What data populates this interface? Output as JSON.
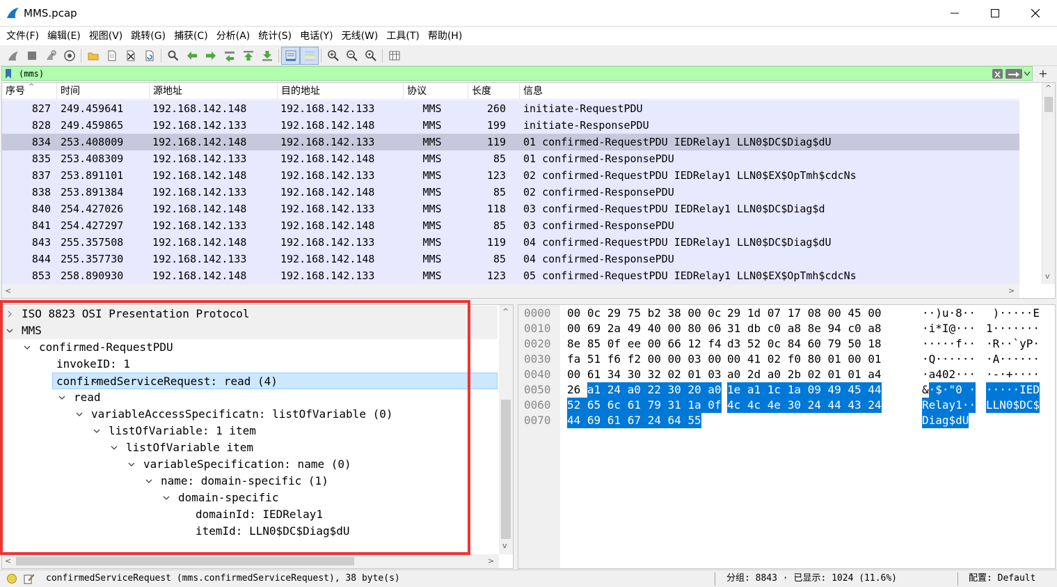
{
  "window": {
    "title": "MMS.pcap"
  },
  "menu": [
    {
      "label": "文件(F)"
    },
    {
      "label": "编辑(E)"
    },
    {
      "label": "视图(V)"
    },
    {
      "label": "跳转(G)"
    },
    {
      "label": "捕获(C)"
    },
    {
      "label": "分析(A)"
    },
    {
      "label": "统计(S)"
    },
    {
      "label": "电话(Y)"
    },
    {
      "label": "无线(W)"
    },
    {
      "label": "工具(T)"
    },
    {
      "label": "帮助(H)"
    }
  ],
  "toolbar": {
    "icons": [
      "shark-fin-start-icon",
      "stop-icon",
      "restart-icon",
      "capture-options-icon",
      "open-file-icon",
      "file-icon",
      "close-file-icon",
      "reload-icon",
      "find-icon",
      "back-arrow-icon",
      "forward-arrow-icon",
      "go-to-packet-icon",
      "first-packet-icon",
      "last-packet-icon",
      "autoscroll-icon",
      "colorize-icon",
      "zoom-in-icon",
      "zoom-out-icon",
      "zoom-reset-icon",
      "resize-columns-icon"
    ]
  },
  "filter": {
    "value": "(mms)",
    "bg_color": "#afffaf"
  },
  "packet_list": {
    "columns": [
      "序号",
      "时间",
      "源地址",
      "目的地址",
      "协议",
      "长度",
      "信息"
    ],
    "rows": [
      {
        "no": "827",
        "time": "249.459641",
        "src": "192.168.142.148",
        "dst": "192.168.142.133",
        "proto": "MMS",
        "len": "260",
        "info": "initiate-RequestPDU",
        "selected": false
      },
      {
        "no": "828",
        "time": "249.459865",
        "src": "192.168.142.133",
        "dst": "192.168.142.148",
        "proto": "MMS",
        "len": "199",
        "info": "initiate-ResponsePDU",
        "selected": false
      },
      {
        "no": "834",
        "time": "253.408009",
        "src": "192.168.142.148",
        "dst": "192.168.142.133",
        "proto": "MMS",
        "len": "119",
        "info": "01 confirmed-RequestPDU IEDRelay1 LLN0$DC$Diag$dU",
        "selected": true
      },
      {
        "no": "835",
        "time": "253.408309",
        "src": "192.168.142.133",
        "dst": "192.168.142.148",
        "proto": "MMS",
        "len": "85",
        "info": "01 confirmed-ResponsePDU",
        "selected": false
      },
      {
        "no": "837",
        "time": "253.891101",
        "src": "192.168.142.148",
        "dst": "192.168.142.133",
        "proto": "MMS",
        "len": "123",
        "info": "02 confirmed-RequestPDU IEDRelay1 LLN0$EX$OpTmh$cdcNs",
        "selected": false
      },
      {
        "no": "838",
        "time": "253.891384",
        "src": "192.168.142.133",
        "dst": "192.168.142.148",
        "proto": "MMS",
        "len": "85",
        "info": "02 confirmed-ResponsePDU",
        "selected": false
      },
      {
        "no": "840",
        "time": "254.427026",
        "src": "192.168.142.148",
        "dst": "192.168.142.133",
        "proto": "MMS",
        "len": "118",
        "info": "03 confirmed-RequestPDU IEDRelay1 LLN0$DC$Diag$d",
        "selected": false
      },
      {
        "no": "841",
        "time": "254.427297",
        "src": "192.168.142.133",
        "dst": "192.168.142.148",
        "proto": "MMS",
        "len": "85",
        "info": "03 confirmed-ResponsePDU",
        "selected": false
      },
      {
        "no": "843",
        "time": "255.357508",
        "src": "192.168.142.148",
        "dst": "192.168.142.133",
        "proto": "MMS",
        "len": "119",
        "info": "04 confirmed-RequestPDU IEDRelay1 LLN0$DC$Diag$dU",
        "selected": false
      },
      {
        "no": "844",
        "time": "255.357730",
        "src": "192.168.142.133",
        "dst": "192.168.142.148",
        "proto": "MMS",
        "len": "85",
        "info": "04 confirmed-ResponsePDU",
        "selected": false
      },
      {
        "no": "853",
        "time": "258.890930",
        "src": "192.168.142.148",
        "dst": "192.168.142.133",
        "proto": "MMS",
        "len": "123",
        "info": "05 confirmed-RequestPDU IEDRelay1 LLN0$EX$OpTmh$cdcNs",
        "selected": false
      }
    ],
    "row_color": "#e8e8ff",
    "selected_color": "#c8c8dc"
  },
  "details": {
    "rows": [
      {
        "text": "ISO 8823 OSI Presentation Protocol",
        "level": 0,
        "expanded": false,
        "selected": false
      },
      {
        "text": "MMS",
        "level": 0,
        "expanded": true,
        "selected": false
      },
      {
        "text": "confirmed-RequestPDU",
        "level": 1,
        "expanded": true,
        "selected": false
      },
      {
        "text": "invokeID: 1",
        "level": 2,
        "expanded": null,
        "selected": false
      },
      {
        "text": "confirmedServiceRequest: read (4)",
        "level": 2,
        "expanded": true,
        "selected": true
      },
      {
        "text": "read",
        "level": 3,
        "expanded": true,
        "selected": false
      },
      {
        "text": "variableAccessSpecificatn: listOfVariable (0)",
        "level": 4,
        "expanded": true,
        "selected": false
      },
      {
        "text": "listOfVariable: 1 item",
        "level": 5,
        "expanded": true,
        "selected": false
      },
      {
        "text": "listOfVariable item",
        "level": 6,
        "expanded": true,
        "selected": false
      },
      {
        "text": "variableSpecification: name (0)",
        "level": 7,
        "expanded": true,
        "selected": false
      },
      {
        "text": "name: domain-specific (1)",
        "level": 8,
        "expanded": true,
        "selected": false
      },
      {
        "text": "domain-specific",
        "level": 9,
        "expanded": true,
        "selected": false
      },
      {
        "text": "domainId: IEDRelay1",
        "level": 10,
        "expanded": null,
        "selected": false
      },
      {
        "text": "itemId: LLN0$DC$Diag$dU",
        "level": 10,
        "expanded": null,
        "selected": false
      }
    ],
    "highlight_color": "#ee3333"
  },
  "bytes": {
    "rows": [
      {
        "offset": "0000",
        "hex1": "00 0c 29 75 b2 38 00 0c",
        "hex2": "29 1d 07 17 08 00 45 00",
        "hl_from": null,
        "ascii1": "··)u·8··",
        "ascii2": " )·····E"
      },
      {
        "offset": "0010",
        "hex1": "00 69 2a 49 40 00 80 06",
        "hex2": "31 db c0 a8 8e 94 c0 a8",
        "hl_from": null,
        "ascii1": "·i*I@···",
        "ascii2": "1·······"
      },
      {
        "offset": "0020",
        "hex1": "8e 85 0f ee 00 66 12 f4",
        "hex2": "d3 52 0c 84 60 79 50 18",
        "hl_from": null,
        "ascii1": "·····f··",
        "ascii2": "·R··`yP·"
      },
      {
        "offset": "0030",
        "hex1": "fa 51 f6 f2 00 00 03 00",
        "hex2": "00 41 02 f0 80 01 00 01",
        "hl_from": null,
        "ascii1": "·Q······",
        "ascii2": "·A······"
      },
      {
        "offset": "0040",
        "hex1": "00 61 34 30 32 02 01 03",
        "hex2": "a0 2d a0 2b 02 01 01 a4",
        "hl_from": null,
        "ascii1": "·a402···",
        "ascii2": "·-·+····"
      },
      {
        "offset": "0050",
        "hex1": "26 a1 24 a0 22 30 20 a0",
        "hex2": "1e a1 1c 1a 09 49 45 44",
        "hl_from": 1,
        "ascii1": "&·$·\"0 ·",
        "ascii2": "·····IED"
      },
      {
        "offset": "0060",
        "hex1": "52 65 6c 61 79 31 1a 0f",
        "hex2": "4c 4c 4e 30 24 44 43 24",
        "hl_from": 0,
        "ascii1": "Relay1··",
        "ascii2": "LLN0$DC$"
      },
      {
        "offset": "0070",
        "hex1": "44 69 61 67 24 64 55",
        "hex2": "",
        "hl_from": 0,
        "ascii1": "Diag$dU",
        "ascii2": ""
      }
    ],
    "highlight_color": "#0078d7"
  },
  "status": {
    "field_info": "confirmedServiceRequest (mms.confirmedServiceRequest), 38 byte(s)",
    "packets": "分组: 8843 · 已显示: 1024 (11.6%)",
    "profile": "配置: Default"
  }
}
